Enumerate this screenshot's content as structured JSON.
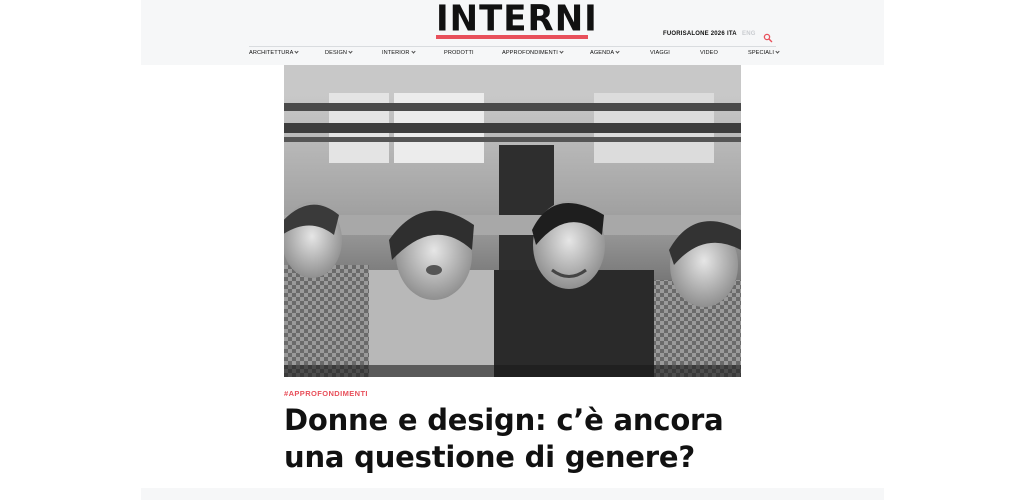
{
  "header": {
    "logo": "INTERNI",
    "fuorisalone": "FUORISALONE 2026",
    "lang_active": "ITA",
    "lang_inactive": "ENG",
    "search_icon": "search-icon",
    "accent_color": "#e8505b"
  },
  "nav": {
    "items": [
      {
        "label": "ARCHITETTURA",
        "dropdown": true
      },
      {
        "label": "DESIGN",
        "dropdown": true
      },
      {
        "label": "INTERIOR",
        "dropdown": true
      },
      {
        "label": "PRODOTTI",
        "dropdown": false
      },
      {
        "label": "APPROFONDIMENTI",
        "dropdown": true
      },
      {
        "label": "AGENDA",
        "dropdown": true
      },
      {
        "label": "VIAGGI",
        "dropdown": false
      },
      {
        "label": "VIDEO",
        "dropdown": false
      },
      {
        "label": "SPECIALI",
        "dropdown": true
      }
    ]
  },
  "article": {
    "image": "black-and-white photo of four women smiling through a window",
    "tag": "#APPROFONDIMENTI",
    "title_line1": "Donne e design: c’è ancora",
    "title_line2": "una questione di genere?"
  }
}
